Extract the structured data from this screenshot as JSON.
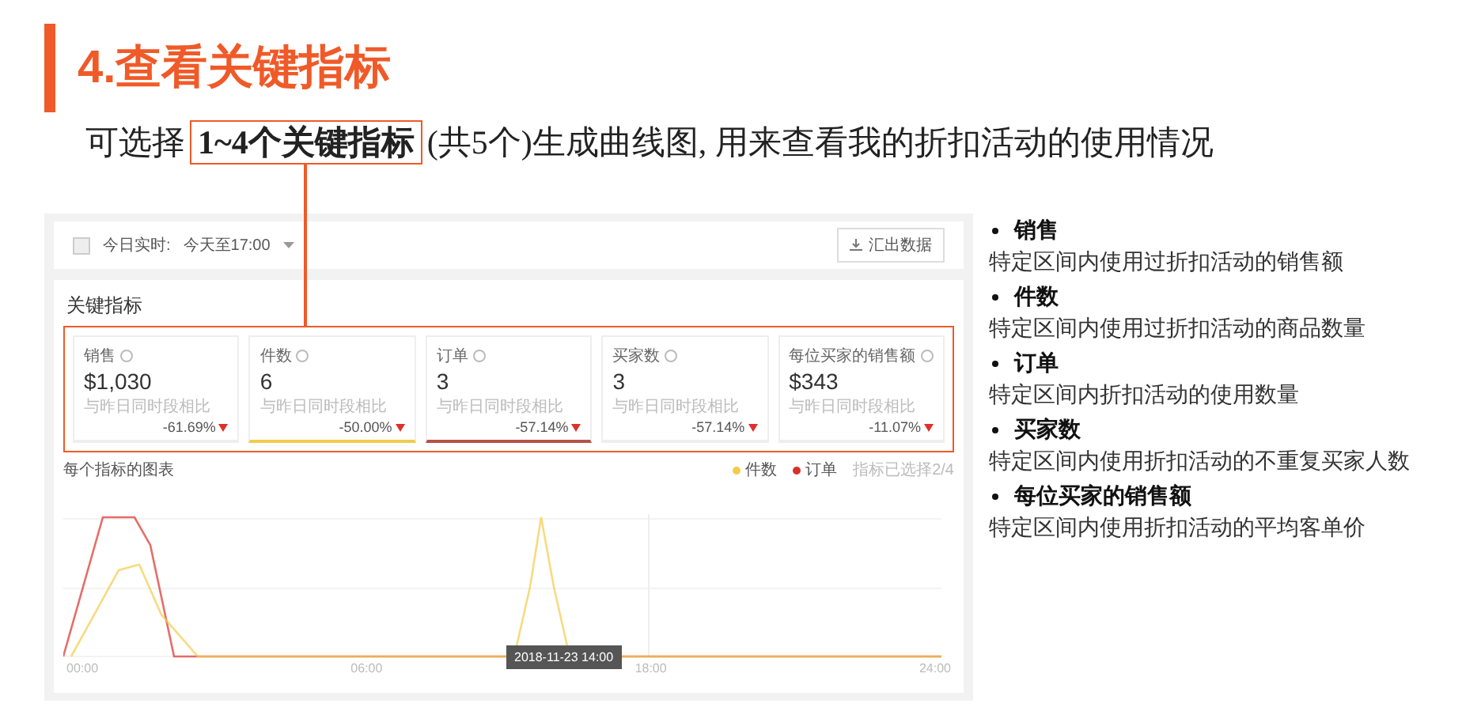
{
  "slide": {
    "title": "4.查看关键指标",
    "subtitle": "可选择**1~4个关键指标**(共5个)生成曲线图, 用来查看我的折扣活动的使用情况"
  },
  "screenshot": {
    "filter": {
      "label": "今日实时:",
      "value": "今天至17:00"
    },
    "export_button": "汇出数据",
    "section_title": "关键指标",
    "metrics": [
      {
        "name": "销售",
        "value": "$1,030",
        "compare": "与昨日同时段相比",
        "change": "-61.69%",
        "selected": false
      },
      {
        "name": "件数",
        "value": "6",
        "compare": "与昨日同时段相比",
        "change": "-50.00%",
        "selected": true,
        "color": "#f2cc4a"
      },
      {
        "name": "订单",
        "value": "3",
        "compare": "与昨日同时段相比",
        "change": "-57.14%",
        "selected": true,
        "color": "#b5524a"
      },
      {
        "name": "买家数",
        "value": "3",
        "compare": "与昨日同时段相比",
        "change": "-57.14%",
        "selected": false
      },
      {
        "name": "每位买家的销售额",
        "value": "$343",
        "compare": "与昨日同时段相比",
        "change": "-11.07%",
        "selected": false
      }
    ],
    "chart_title": "每个指标的图表",
    "legend": [
      {
        "label": "件数",
        "color": "#f2cc4a"
      },
      {
        "label": "订单",
        "color": "#d9302b"
      }
    ],
    "legend_note": "指标已选择2/4",
    "x_labels": [
      "00:00",
      "06:00",
      "18:00",
      "24:00"
    ],
    "tooltip": "2018-11-23 14:00"
  },
  "notes": [
    {
      "term": "销售",
      "description": "特定区间内使用过折扣活动的销售额"
    },
    {
      "term": "件数",
      "description": "特定区间内使用过折扣活动的商品数量"
    },
    {
      "term": "订单",
      "description": "特定区间内折扣活动的使用数量"
    },
    {
      "term": "买家数",
      "description": "特定区间内使用折扣活动的不重复买家人数"
    },
    {
      "term": "每位买家的销售额",
      "description": "特定区间内使用折扣活动的平均客单价"
    }
  ]
}
